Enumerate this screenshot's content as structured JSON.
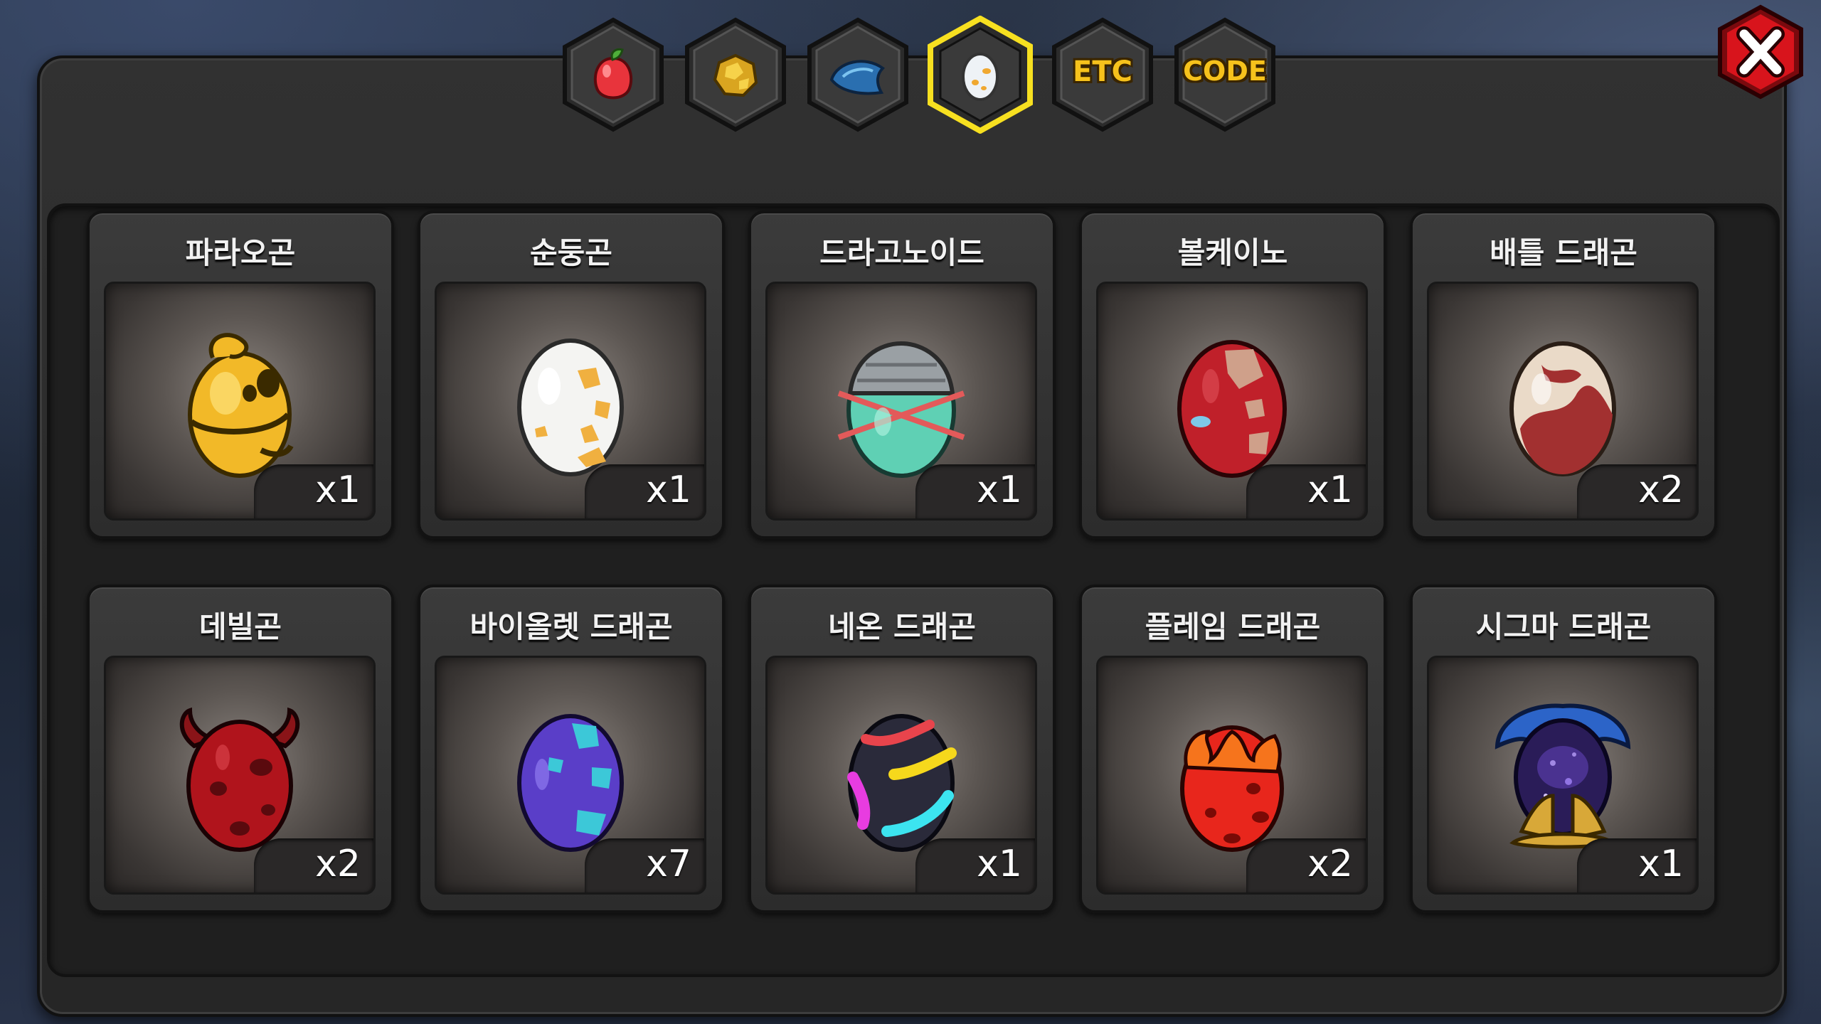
{
  "tabs": [
    {
      "name": "fruit",
      "label": "",
      "icon": "fruit-icon",
      "selected": false
    },
    {
      "name": "gold",
      "label": "",
      "icon": "gold-ore-icon",
      "selected": false
    },
    {
      "name": "scale",
      "label": "",
      "icon": "blue-scale-icon",
      "selected": false
    },
    {
      "name": "egg",
      "label": "",
      "icon": "egg-icon",
      "selected": true
    },
    {
      "name": "etc",
      "label": "ETC",
      "icon": "",
      "selected": false
    },
    {
      "name": "code",
      "label": "CODE",
      "icon": "",
      "selected": false
    }
  ],
  "close_icon": "close-x-icon",
  "colors": {
    "tab_gold": "#f6c21c",
    "selected_border": "#f7e020",
    "close_red": "#d8141c"
  },
  "items": [
    {
      "name": "파라오곤",
      "qty": "x1",
      "icon": "pharaoh-egg"
    },
    {
      "name": "순둥곤",
      "qty": "x1",
      "icon": "white-gold-egg"
    },
    {
      "name": "드라고노이드",
      "qty": "x1",
      "icon": "teal-dragonoid-egg"
    },
    {
      "name": "볼케이노",
      "qty": "x1",
      "icon": "red-volcano-egg"
    },
    {
      "name": "배틀 드래곤",
      "qty": "x2",
      "icon": "battle-dragon-egg"
    },
    {
      "name": "데빌곤",
      "qty": "x2",
      "icon": "devil-egg"
    },
    {
      "name": "바이올렛 드래곤",
      "qty": "x7",
      "icon": "violet-dragon-egg"
    },
    {
      "name": "네온 드래곤",
      "qty": "x1",
      "icon": "neon-dragon-egg"
    },
    {
      "name": "플레임 드래곤",
      "qty": "x2",
      "icon": "flame-dragon-egg"
    },
    {
      "name": "시그마 드래곤",
      "qty": "x1",
      "icon": "sigma-dragon-egg"
    }
  ]
}
